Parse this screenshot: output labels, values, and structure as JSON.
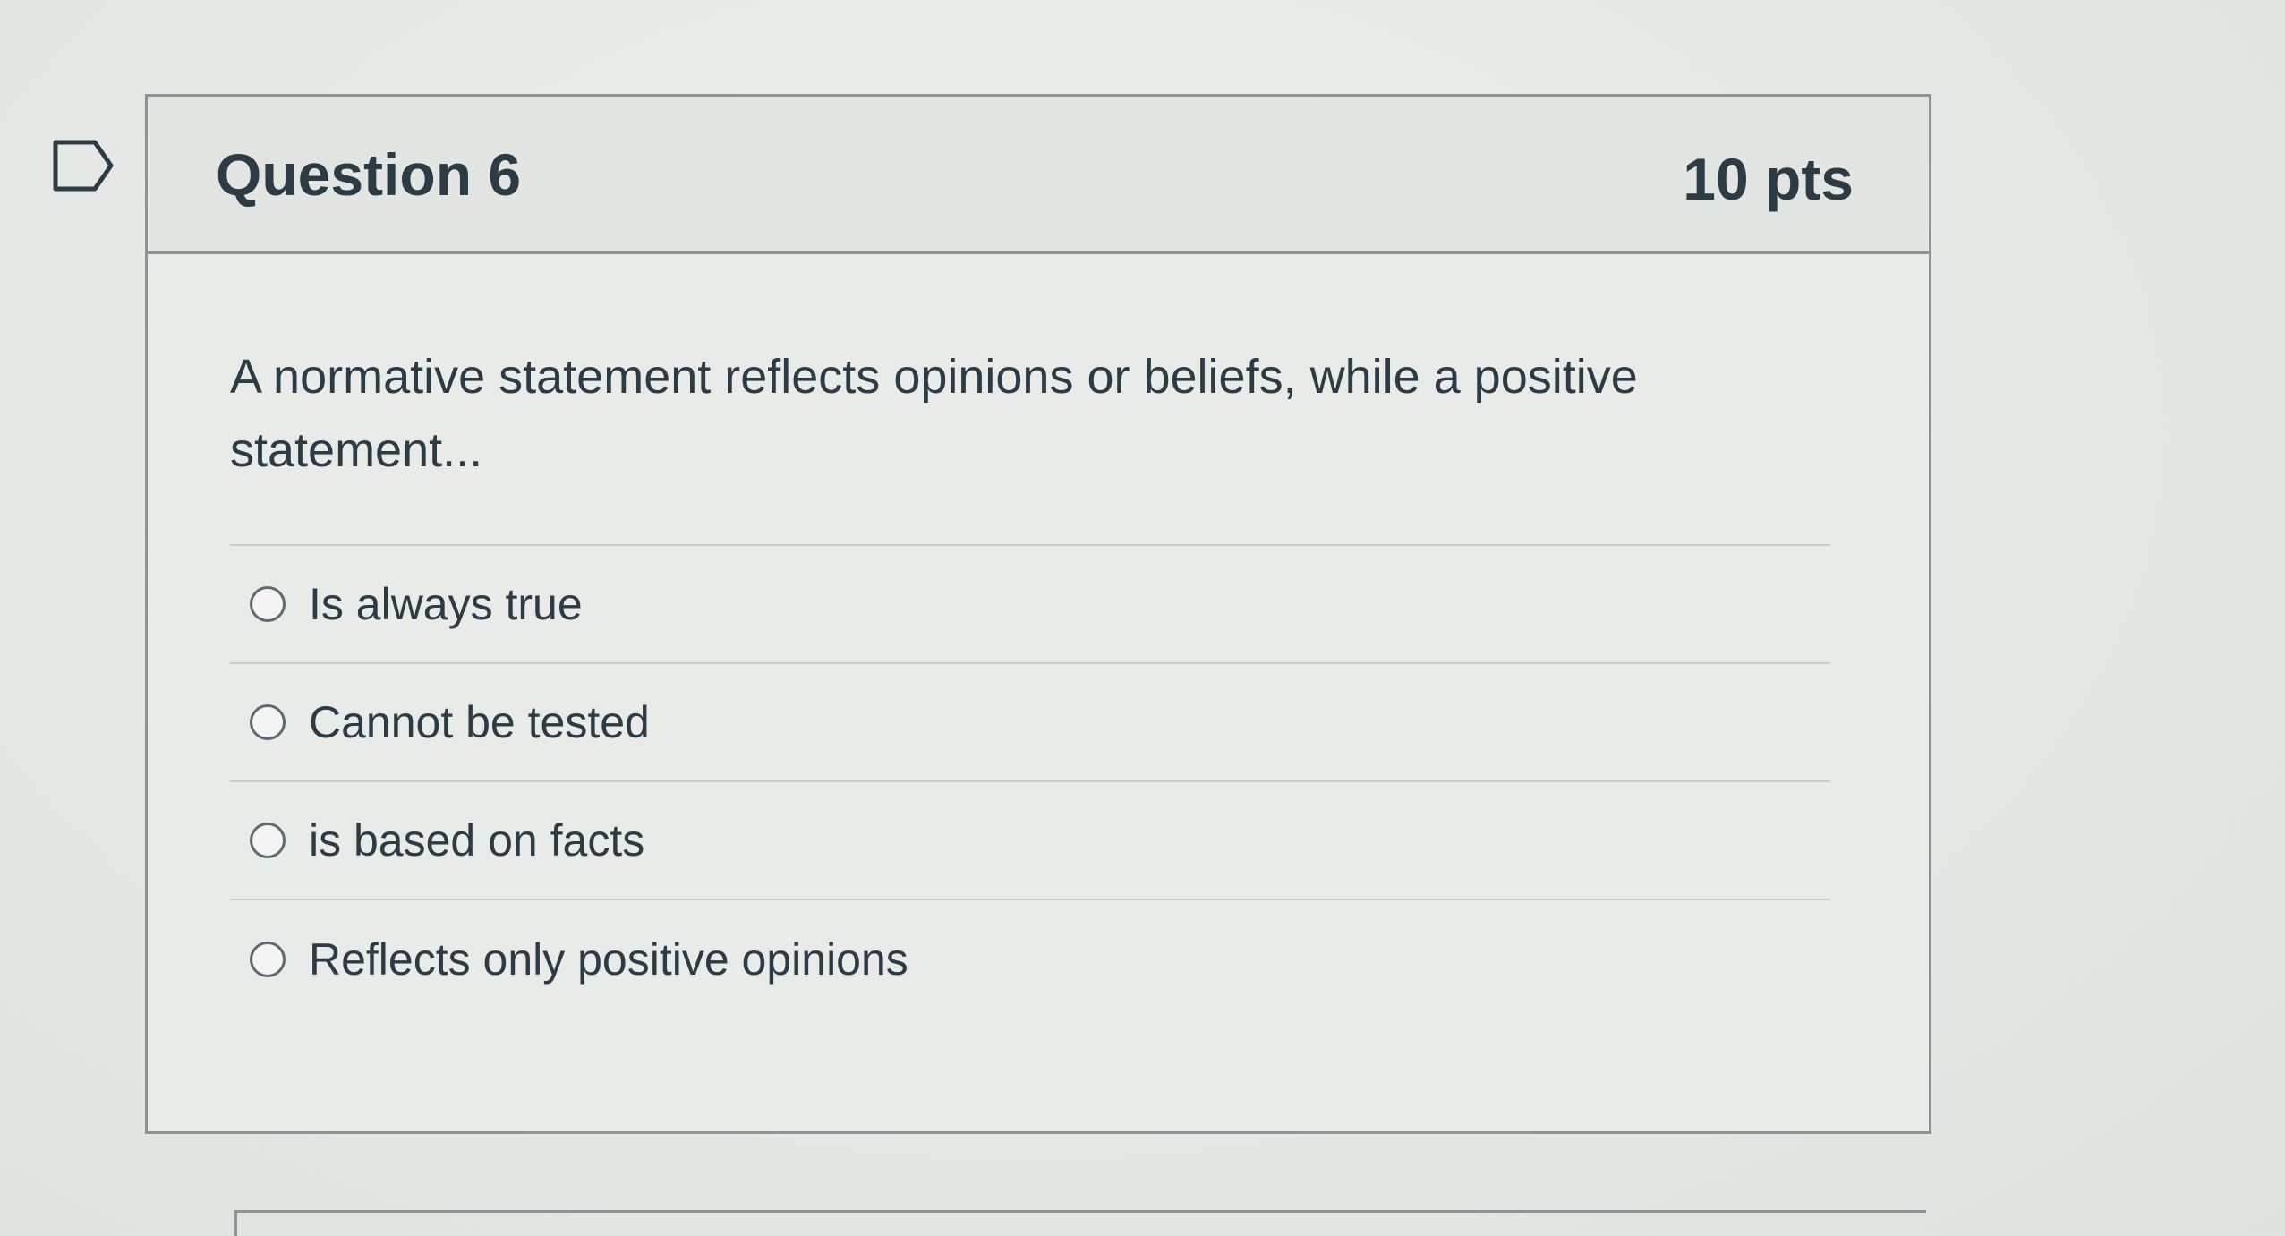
{
  "question": {
    "title": "Question 6",
    "points": "10 pts",
    "text": "A normative statement reflects opinions or beliefs, while a positive statement...",
    "answers": [
      {
        "label": "Is always true"
      },
      {
        "label": "Cannot be tested"
      },
      {
        "label": "is based on facts"
      },
      {
        "label": "Reflects only positive opinions"
      }
    ]
  },
  "icons": {
    "bookmark": "bookmark-flag-icon",
    "radio": "radio-unchecked-icon"
  },
  "colors": {
    "text": "#2d3b45",
    "border": "#8e9396",
    "divider": "#c9cccb",
    "background": "#e7e9e6"
  }
}
